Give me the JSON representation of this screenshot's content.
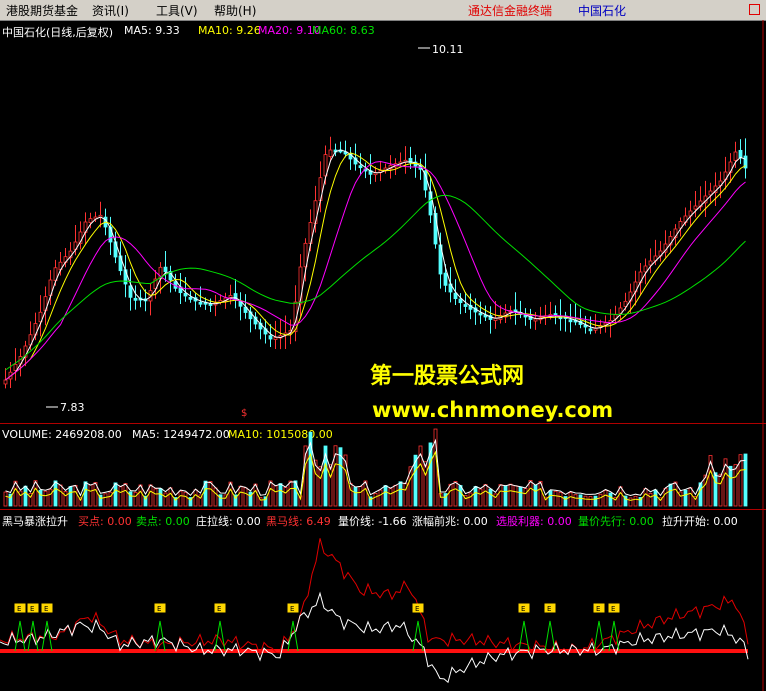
{
  "menu": {
    "items": [
      "港股期货基金",
      "资讯(I)",
      "工具(V)",
      "帮助(H)"
    ],
    "brand": "通达信金融终端",
    "stock": "中国石化"
  },
  "price_panel": {
    "title": "中国石化(日线,后复权)",
    "ma5": "MA5: 9.33",
    "ma10": "MA10: 9.26",
    "ma20": "MA20: 9.10",
    "ma60": "MA60: 8.63",
    "high_label": "10.11",
    "low_label": "7.83",
    "marker": "$"
  },
  "volume_panel": {
    "volume": "VOLUME: 2469208.00",
    "ma5": "MA5: 1249472.00",
    "ma10": "MA10: 1015080.00"
  },
  "indicator_panel": {
    "name": "黑马暴涨拉升",
    "buy": "买点: 0.00",
    "sell": "卖点: 0.00",
    "zhuang": "庄拉线: 0.00",
    "heima": "黑马线: 6.49",
    "liangjia": "量价线: -1.66",
    "zhangfu": "涨幅前兆: 0.00",
    "xuangu": "选股利器: 0.00",
    "liangjia_xx": "量价先行: 0.00",
    "lasheng": "拉升开始: 0.00",
    "flag_text": "E"
  },
  "watermark": {
    "line1": "第一股票公式网",
    "line2": "www.chnmoney.com"
  },
  "colors": {
    "up": "#ff3232",
    "down": "#54ffff",
    "ma5": "#ffffff",
    "ma10": "#ffff00",
    "ma20": "#ff00ff",
    "ma60": "#00e000",
    "bg": "#000000",
    "menu_bg": "#d4d0c8"
  },
  "chart_data": {
    "type": "candlestick",
    "title": "中国石化(日线,后复权)",
    "ylim": [
      7.7,
      10.25
    ],
    "annotated_high": 10.11,
    "annotated_low": 7.83,
    "series": [
      {
        "name": "MA5",
        "last": 9.33
      },
      {
        "name": "MA10",
        "last": 9.26
      },
      {
        "name": "MA20",
        "last": 9.1
      },
      {
        "name": "MA60",
        "last": 8.63
      }
    ]
  }
}
